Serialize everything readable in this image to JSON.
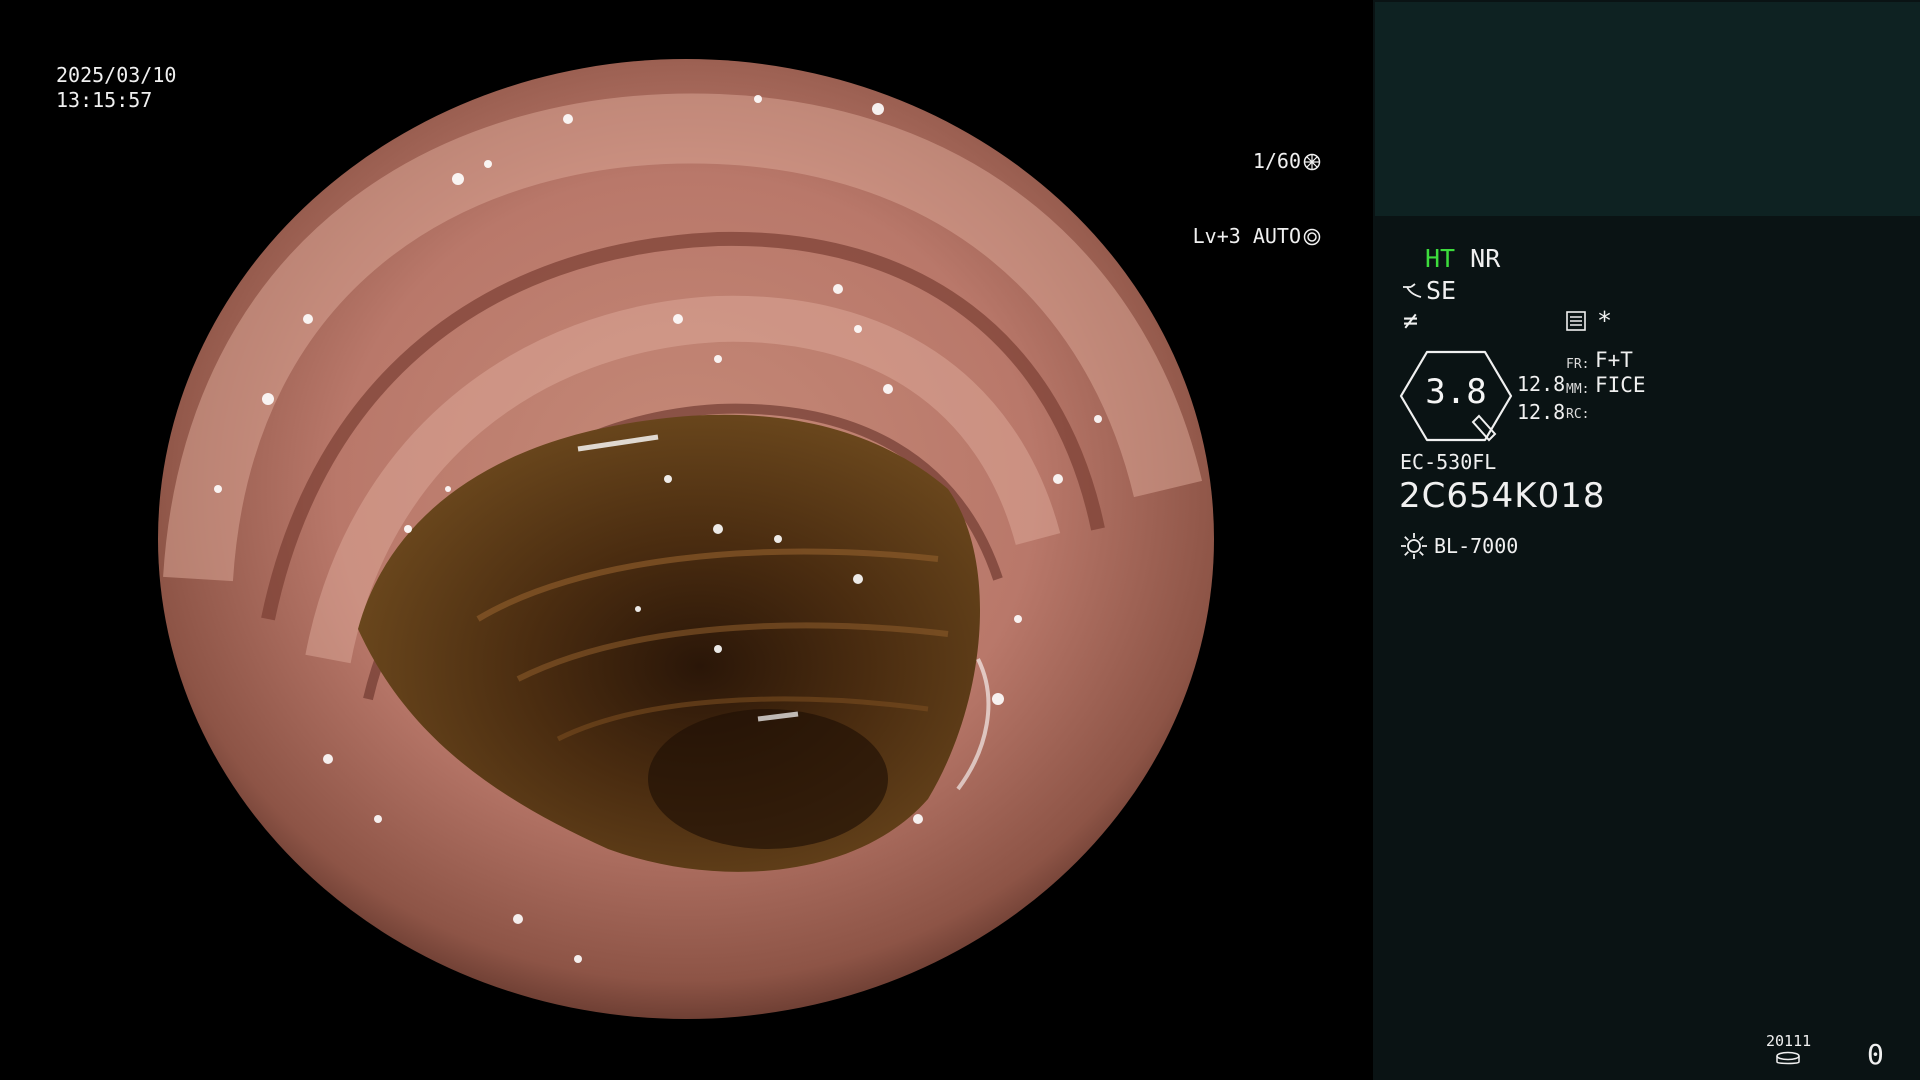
{
  "view": {
    "date": "2025/03/10",
    "time": "13:15:57",
    "shutter": "1/60",
    "iris": "Lv+3 AUTO"
  },
  "panel": {
    "mode_ht": "HT",
    "mode_nr": "NR",
    "enhance": "SE",
    "zoom": "3.8",
    "zoom_value_1": "12.8",
    "zoom_value_2": "12.8",
    "fr_label": "FR:",
    "fr_value": "F+T",
    "mm_label": "MM:",
    "mm_value": "FICE",
    "rc_label": "RC:",
    "scope_model": "EC-530FL",
    "scope_serial": "2C654K018",
    "light_source": "BL-7000",
    "record_count": "20111",
    "counter": "0"
  },
  "colors": {
    "panel_bg": "#0a1314",
    "thumb_bg": "#0e2222",
    "ht_green": "#3ddc3d",
    "text": "#f0f0f0"
  }
}
